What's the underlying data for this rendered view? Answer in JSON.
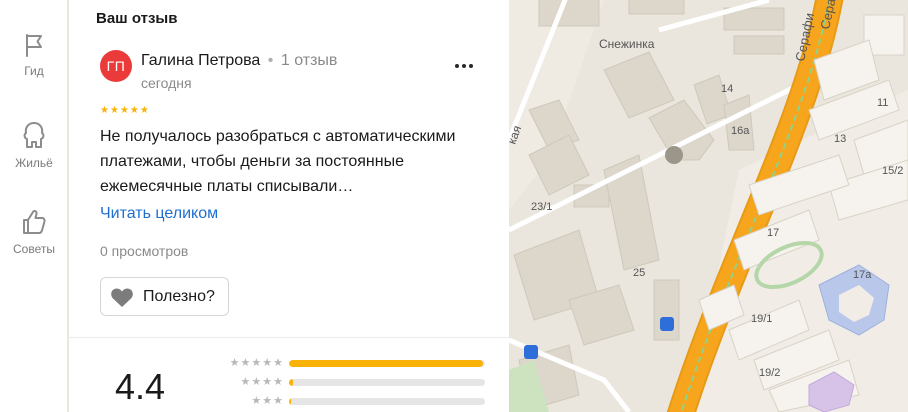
{
  "rail": {
    "items": [
      {
        "label": "Гид",
        "icon": "flag-icon"
      },
      {
        "label": "Жильё",
        "icon": "house-icon"
      },
      {
        "label": "Советы",
        "icon": "thumbs-up-icon"
      }
    ]
  },
  "review": {
    "section_title": "Ваш отзыв",
    "author": {
      "initials": "ГП",
      "name": "Галина Петрова",
      "separator": "•",
      "review_count": "1 отзыв",
      "avatar_color": "#ea3a3a"
    },
    "date": "сегодня",
    "rating_stars": 5,
    "text": "Не получалось разобраться с автоматическими платежами, чтобы деньги за постоянные ежемесячные платы списывали…",
    "read_more": "Читать целиком",
    "views": "0 просмотров",
    "useful_label": "Полезно?",
    "more_icon": "more-dots-icon"
  },
  "rating_summary": {
    "average": "4.4",
    "distribution": [
      {
        "stars": 5,
        "fraction": 0.99
      },
      {
        "stars": 4,
        "fraction": 0.02
      },
      {
        "stars": 3,
        "fraction": 0.01
      }
    ],
    "accent_color": "#f9b308"
  },
  "map": {
    "labels": {
      "snezhinka": "Снежинка",
      "b14": "14",
      "b16a": "16а",
      "b23_1": "23/1",
      "b25": "25",
      "b17": "17",
      "b17a": "17а",
      "b13": "13",
      "b15_2": "15/2",
      "b11": "11",
      "b19_1": "19/1",
      "b19_2": "19/2",
      "street_partial": "кая",
      "serafimovicha_1": "Серафи",
      "serafimovicha_2": "Серафи"
    },
    "road_color": "#f7a51c"
  }
}
